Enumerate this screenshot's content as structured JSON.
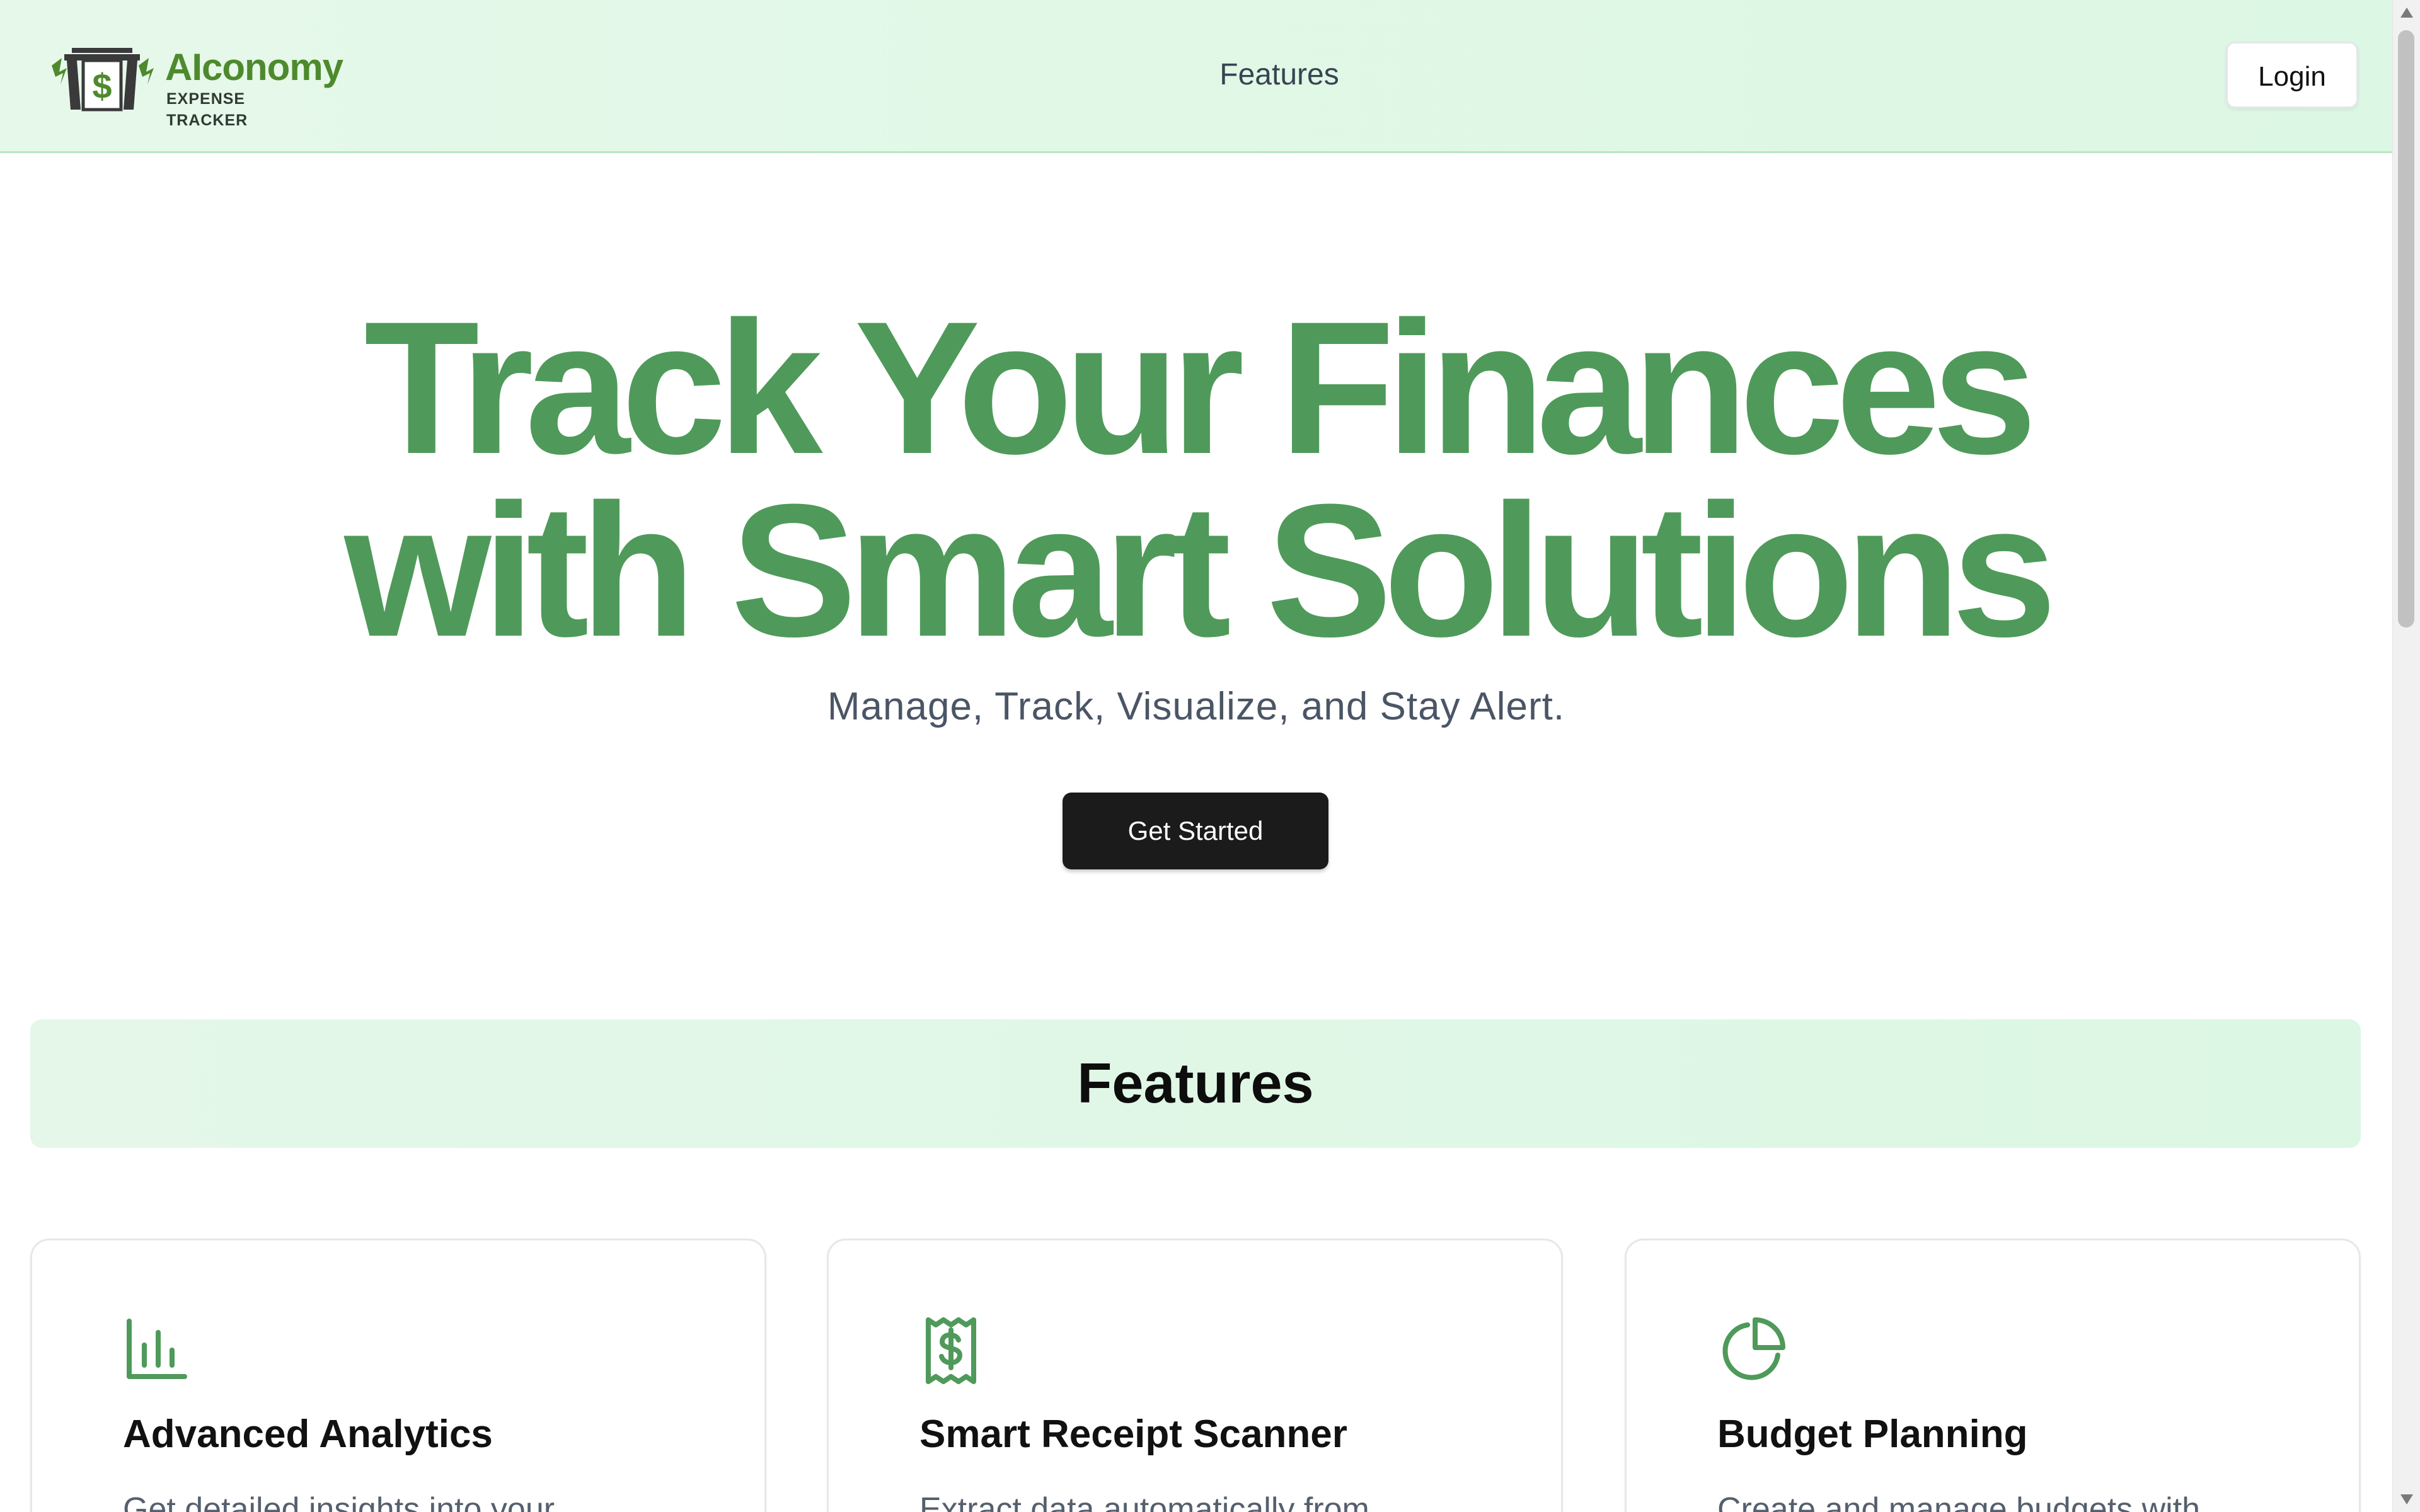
{
  "header": {
    "logo": {
      "title": "AIconomy",
      "subtitle": "EXPENSE TRACKER",
      "mark_icon": "dollar-bill-icon"
    },
    "nav": {
      "features_label": "Features"
    },
    "login_label": "Login"
  },
  "hero": {
    "title_line1": "Track Your Finances",
    "title_line2": "with Smart Solutions",
    "subtitle": "Manage, Track, Visualize, and Stay Alert.",
    "cta_label": "Get Started"
  },
  "features": {
    "heading": "Features",
    "cards": [
      {
        "icon": "bar-chart-icon",
        "title": "Advanced Analytics",
        "description": "Get detailed insights into your"
      },
      {
        "icon": "receipt-icon",
        "title": "Smart Receipt Scanner",
        "description": "Extract data automatically from"
      },
      {
        "icon": "pie-chart-icon",
        "title": "Budget Planning",
        "description": "Create and manage budgets with"
      }
    ]
  },
  "colors": {
    "brand_green": "#4f9a5a",
    "logo_green": "#4e8a2d",
    "header_bg": "#dcf7e3",
    "cta_bg": "#1b1b1b"
  }
}
